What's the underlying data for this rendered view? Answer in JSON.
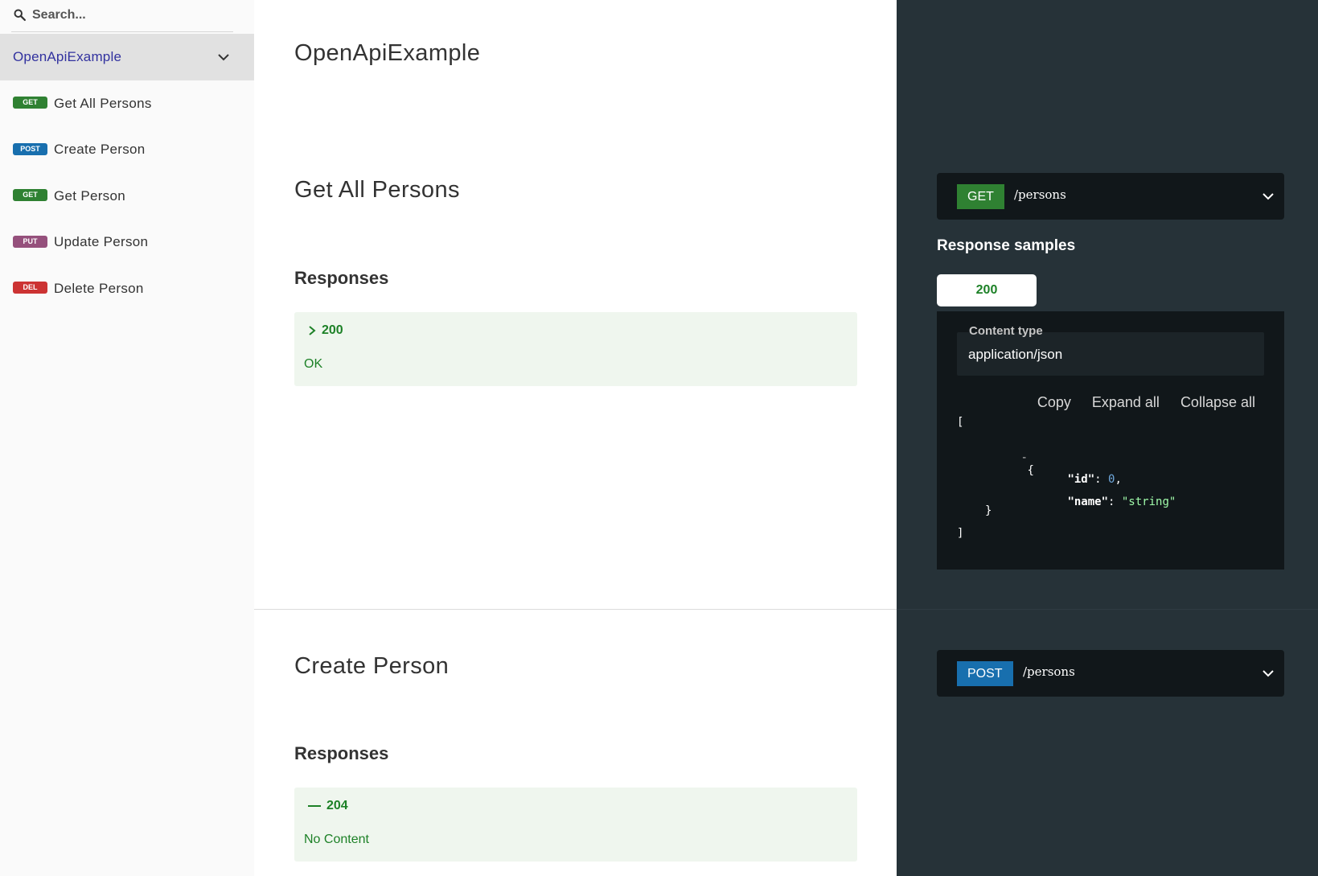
{
  "search": {
    "placeholder": "Search..."
  },
  "sidebar": {
    "group_label": "OpenApiExample",
    "items": [
      {
        "method": "GET",
        "label": "Get All Persons",
        "color": "#2f8132"
      },
      {
        "method": "POST",
        "label": "Create Person",
        "color": "#186fae"
      },
      {
        "method": "GET",
        "label": "Get Person",
        "color": "#2f8132"
      },
      {
        "method": "PUT",
        "label": "Update Person",
        "color": "#95507c"
      },
      {
        "method": "DEL",
        "label": "Delete Person",
        "color": "#cc3333"
      }
    ]
  },
  "main": {
    "api_title": "OpenApiExample",
    "operations": [
      {
        "title": "Get All Persons",
        "responses_label": "Responses",
        "code": "200",
        "description": "OK"
      },
      {
        "title": "Create Person",
        "responses_label": "Responses",
        "code": "204",
        "description": "No Content"
      }
    ]
  },
  "right": {
    "endpoints": [
      {
        "method": "GET",
        "path": "/persons",
        "color": "#2f8132"
      },
      {
        "method": "POST",
        "path": "/persons",
        "color": "#186fae"
      }
    ],
    "response_samples_title": "Response samples",
    "tab_label": "200",
    "content_type_label": "Content type",
    "content_type_value": "application/json",
    "tools": {
      "copy": "Copy",
      "expand": "Expand all",
      "collapse": "Collapse all"
    },
    "sample": {
      "open_bracket": "[",
      "toggle": "-",
      "open_brace": "{",
      "id_key": "\"id\"",
      "id_value": "0",
      "name_key": "\"name\"",
      "name_value": "\"string\"",
      "close_brace": "}",
      "close_bracket": "]"
    }
  },
  "colors": {
    "accent_link": "#32329f",
    "success_green": "#1d8127",
    "dark_panel": "#263238",
    "code_bg": "#11171a"
  }
}
